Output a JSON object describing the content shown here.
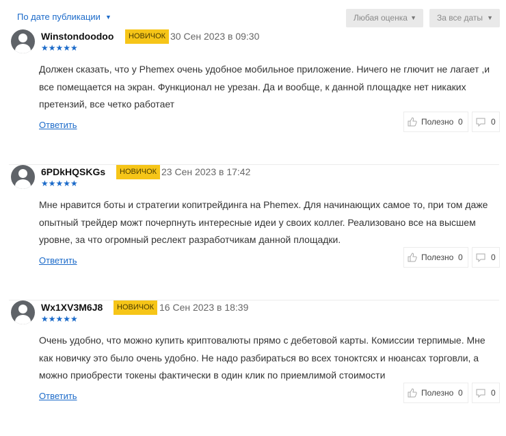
{
  "filters": {
    "sort_label": "По дате публикации",
    "rating_label": "Любая оценка",
    "period_label": "За все даты"
  },
  "reviews": [
    {
      "author": "Winstondoodoo",
      "badge": "НОВИЧОК",
      "date": "30 Сен 2023 в 09:30",
      "stars": "★★★★★",
      "rating": 5,
      "text": "Должен сказать, что у Phemex очень удобное мобильное приложение. Ничего не глючит не лагает ,и все помещается на экран. Функционал не урезан. Да и вообще, к данной площадке нет никаких претензий, все четко работает",
      "reply_label": "Ответить",
      "useful_label": "Полезно",
      "useful_count": "0",
      "dislike_count": "0"
    },
    {
      "author": "6PDkHQSKGs",
      "badge": "НОВИЧОК",
      "date": "23 Сен 2023 в 17:42",
      "stars": "★★★★★",
      "rating": 5,
      "text": "Мне нравится боты и стратегии копитрейдинга на Phemex. Для начинающих самое то, при том даже опытный трейдер можт почерпнуть интересные идеи у своих коллег. Реализовано все на высшем уровне, за что огромный реслект разработчикам данной площадки.",
      "reply_label": "Ответить",
      "useful_label": "Полезно",
      "useful_count": "0",
      "dislike_count": "0"
    },
    {
      "author": "Wx1XV3M6J8",
      "badge": "НОВИЧОК",
      "date": "16 Сен 2023 в 18:39",
      "stars": "★★★★★",
      "rating": 5,
      "text": "Очень удобно, что можно купить криптовалюты прямо с дебетовой карты. Комиссии терпимые. Мне как новичку это было очень удобно. Не надо разбираться во всех тоноктсях и нюансах торговли, а можно приобрести токены фактически в один клик по приемлимой стоимости",
      "reply_label": "Ответить",
      "useful_label": "Полезно",
      "useful_count": "0",
      "dislike_count": "0"
    }
  ],
  "colors": {
    "link": "#1b6ac9",
    "badge": "#f6c518",
    "avatar": "#5f6368"
  },
  "icons": [
    "chevron-down-icon",
    "user-avatar-icon",
    "thumbs-up-icon",
    "comment-icon",
    "star-icon"
  ]
}
